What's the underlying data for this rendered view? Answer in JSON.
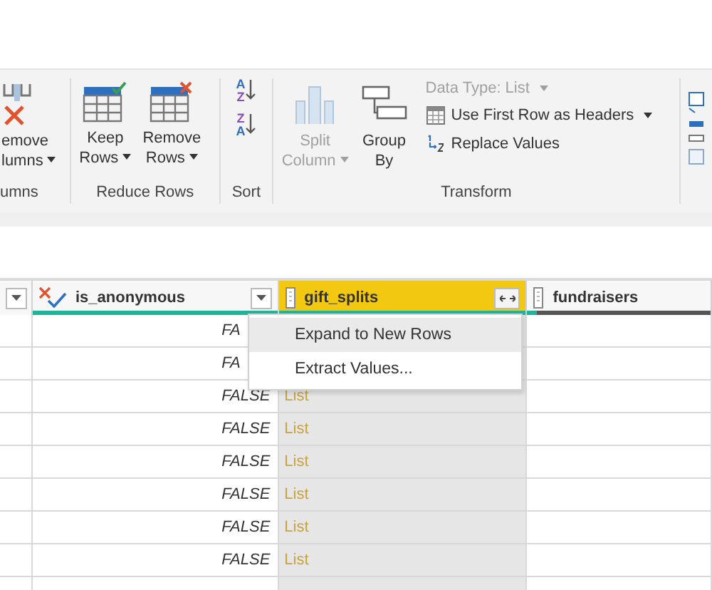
{
  "ribbon": {
    "groups": [
      {
        "label": "umns",
        "buttons": [
          {
            "line1": "emove",
            "line2": "lumns",
            "dropdown": true,
            "disabled": false
          }
        ]
      },
      {
        "label": "Reduce Rows",
        "buttons": [
          {
            "line1": "Keep",
            "line2": "Rows",
            "dropdown": true,
            "disabled": false
          },
          {
            "line1": "Remove",
            "line2": "Rows",
            "dropdown": true,
            "disabled": false
          }
        ]
      },
      {
        "label": "Sort",
        "buttons": [
          {
            "top": "A",
            "bottom": "Z"
          },
          {
            "top": "Z",
            "bottom": "A"
          }
        ]
      },
      {
        "label": "Transform",
        "buttons": [
          {
            "line1": "Split",
            "line2": "Column",
            "dropdown": true,
            "disabled": true
          },
          {
            "line1": "Group",
            "line2": "By",
            "dropdown": false,
            "disabled": false
          }
        ],
        "small_buttons": [
          {
            "label": "Data Type: List",
            "dropdown": true,
            "disabled": true
          },
          {
            "label": "Use First Row as Headers",
            "dropdown": true,
            "disabled": false
          },
          {
            "label": "Replace Values",
            "dropdown": false,
            "disabled": false
          }
        ]
      }
    ]
  },
  "table": {
    "columns": [
      {
        "name": "is_anonymous",
        "kind": "logical",
        "selected": false,
        "level": 1
      },
      {
        "name": "gift_splits",
        "kind": "list",
        "selected": true,
        "level": 1
      },
      {
        "name": "fundraisers",
        "kind": "list",
        "selected": false,
        "level": 0.05
      }
    ],
    "rows": [
      {
        "is_anonymous": "FA"
      },
      {
        "is_anonymous": "FA"
      },
      {
        "is_anonymous": "FALSE",
        "gift_splits": "List"
      },
      {
        "is_anonymous": "FALSE",
        "gift_splits": "List"
      },
      {
        "is_anonymous": "FALSE",
        "gift_splits": "List"
      },
      {
        "is_anonymous": "FALSE",
        "gift_splits": "List"
      },
      {
        "is_anonymous": "FALSE",
        "gift_splits": "List"
      },
      {
        "is_anonymous": "FALSE",
        "gift_splits": "List"
      }
    ]
  },
  "menu": {
    "items": [
      {
        "label": "Expand to New Rows",
        "highlighted": true
      },
      {
        "label": "Extract Values...",
        "highlighted": false
      }
    ]
  }
}
